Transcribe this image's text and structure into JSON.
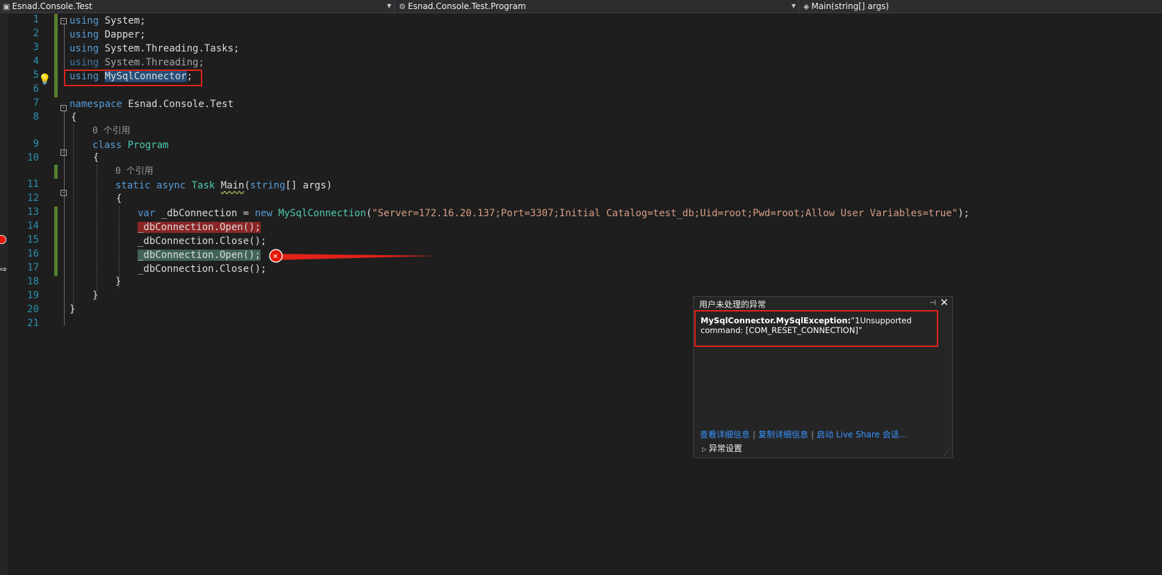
{
  "navbar": {
    "project": "Esnad.Console.Test",
    "type": "Esnad.Console.Test.Program",
    "member": "Main(string[] args)"
  },
  "editor": {
    "line_numbers": [
      "1",
      "2",
      "3",
      "4",
      "5",
      "6",
      "7",
      "8",
      "9",
      "10",
      "11",
      "12",
      "13",
      "14",
      "15",
      "16",
      "17",
      "18",
      "19",
      "20",
      "21"
    ],
    "ref_hint": "0 个引用",
    "code": {
      "using_kw": "using",
      "l1_ns": "System",
      "l2_ns": "Dapper",
      "l3_ns": "System.Threading.Tasks",
      "l4_ns": "System.Threading",
      "l5_ns": "MySqlConnector",
      "semicolon": ";",
      "namespace_kw": "namespace",
      "namespace_name": "Esnad.Console.Test",
      "open_brace": "{",
      "close_brace": "}",
      "class_kw": "class",
      "class_name": "Program",
      "static_kw": "static",
      "async_kw": "async",
      "task_type": "Task",
      "main_name": "Main",
      "params_open": "(",
      "string_kw": "string",
      "params_rest": "[] args)",
      "var_kw": "var",
      "var_name": " _dbConnection = ",
      "new_kw": "new",
      "conn_type": "MySqlConnection",
      "conn_string": "\"Server=172.16.20.137;Port=3307;Initial Catalog=test_db;Uid=root;Pwd=root;Allow User Variables=true\"",
      "l13_end": ");",
      "open_call": "_dbConnection.Open();",
      "close_call": "_dbConnection.Close();"
    }
  },
  "exception_popup": {
    "title": "用户未处理的异常",
    "exception_type": "MySqlConnector.MySqlException:",
    "message": "“1Unsupported command: [COM_RESET_CONNECTION]”",
    "links": [
      "查看详细信息",
      "复制详细信息",
      "启动 Live Share 会话..."
    ],
    "settings_label": "异常设置"
  },
  "colors": {
    "annotation_red": "#e32219",
    "breakpoint_red": "#e51400",
    "keyword": "#569cd6",
    "type": "#4ec9b0",
    "string": "#d69d85",
    "line_number": "#2b91af"
  },
  "icons": [
    "lightbulb-icon",
    "breakpoint-icon",
    "execution-arrow-icon",
    "pin-icon",
    "close-icon",
    "expand-triangle-icon",
    "resize-grip-icon"
  ]
}
